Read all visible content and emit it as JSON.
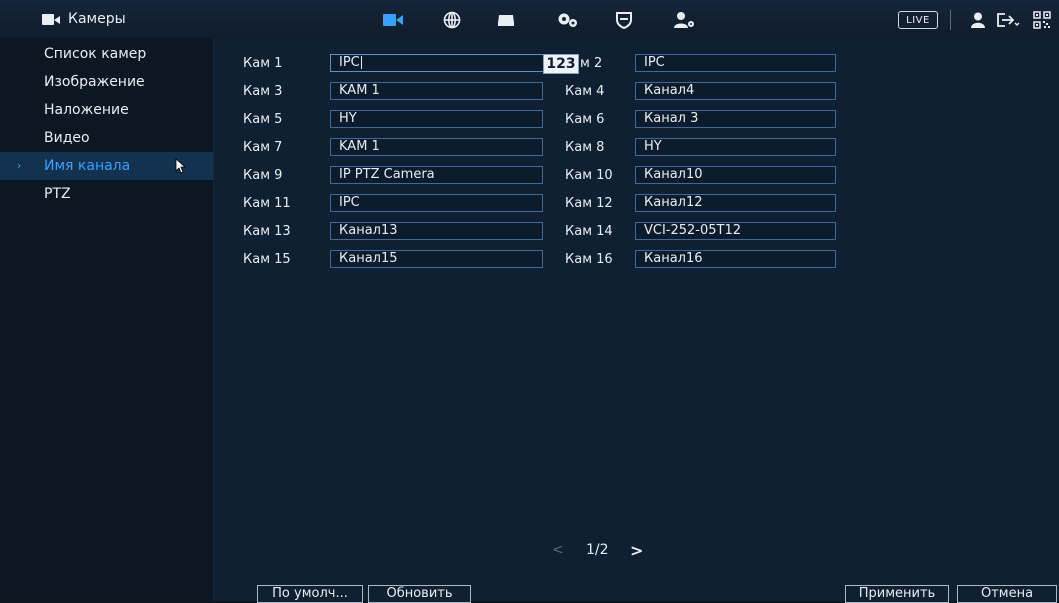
{
  "header": {
    "title": "Камеры",
    "live_label": "LIVE"
  },
  "sidebar": {
    "items": [
      {
        "label": "Список камер"
      },
      {
        "label": "Изображение"
      },
      {
        "label": "Наложение"
      },
      {
        "label": "Видео"
      },
      {
        "label": "Имя канала",
        "active": true
      },
      {
        "label": "PTZ"
      }
    ]
  },
  "channels": [
    {
      "label": "Кам 1",
      "value": "IPC"
    },
    {
      "label": "Кам 2",
      "value": "IPC"
    },
    {
      "label": "Кам 3",
      "value": "KAM 1"
    },
    {
      "label": "Кам 4",
      "value": "Канал4"
    },
    {
      "label": "Кам 5",
      "value": "HY"
    },
    {
      "label": "Кам 6",
      "value": "Канал 3"
    },
    {
      "label": "Кам 7",
      "value": "KAM 1"
    },
    {
      "label": "Кам 8",
      "value": "HY"
    },
    {
      "label": "Кам 9",
      "value": "IP PTZ Camera"
    },
    {
      "label": "Кам 10",
      "value": "Канал10"
    },
    {
      "label": "Кам 11",
      "value": "IPC"
    },
    {
      "label": "Кам 12",
      "value": "Канал12"
    },
    {
      "label": "Кам 13",
      "value": "Канал13"
    },
    {
      "label": "Кам 14",
      "value": "VCI-252-05T12"
    },
    {
      "label": "Кам 15",
      "value": "Канал15"
    },
    {
      "label": "Кам 16",
      "value": "Канал16"
    }
  ],
  "ime_badge": "123",
  "kam2_visible_label": "м 2",
  "pagination": {
    "prev": "<",
    "page": "1/2",
    "next": ">"
  },
  "buttons": {
    "default": "По умолч...",
    "refresh": "Обновить",
    "apply": "Применить",
    "cancel": "Отмена"
  },
  "icons": {
    "nav": [
      "camera-icon",
      "network-icon",
      "storage-icon",
      "system-settings-icon",
      "security-shield-icon",
      "account-settings-icon"
    ],
    "right": [
      "user-icon",
      "logout-icon",
      "qr-code-icon"
    ]
  },
  "colors": {
    "accent": "#3aa0ff",
    "background": "#0e2031",
    "field_border": "#3c6a99"
  }
}
